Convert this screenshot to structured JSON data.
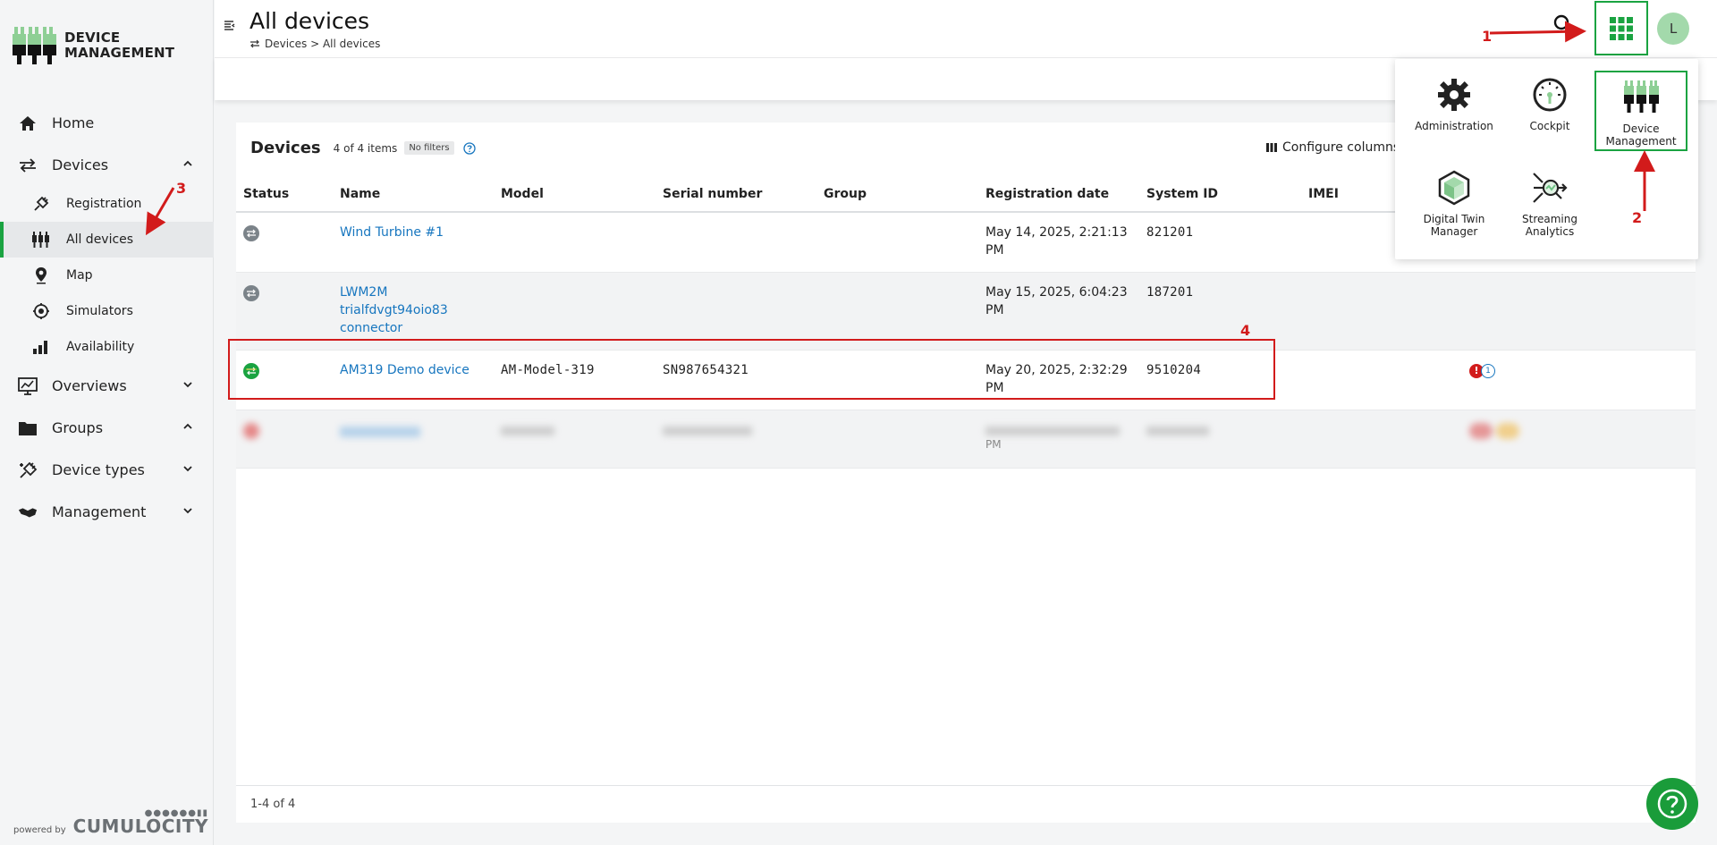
{
  "app": {
    "logo_line1": "DEVICE",
    "logo_line2": "MANAGEMENT",
    "powered_by": "powered by",
    "brand": "CUMULOCITY",
    "accent_color": "#1aa341"
  },
  "sidebar": {
    "items": [
      {
        "label": "Home",
        "icon": "home-icon"
      },
      {
        "label": "Devices",
        "icon": "devices-icon",
        "expanded": true
      },
      {
        "label": "Overviews",
        "icon": "overviews-icon",
        "expanded": false
      },
      {
        "label": "Groups",
        "icon": "groups-icon",
        "expanded": true
      },
      {
        "label": "Device types",
        "icon": "device-types-icon",
        "expanded": false
      },
      {
        "label": "Management",
        "icon": "management-icon",
        "expanded": false
      }
    ],
    "device_subitems": [
      {
        "label": "Registration",
        "icon": "registration-icon"
      },
      {
        "label": "All devices",
        "icon": "all-devices-icon",
        "active": true
      },
      {
        "label": "Map",
        "icon": "map-pin-icon"
      },
      {
        "label": "Simulators",
        "icon": "simulators-icon"
      },
      {
        "label": "Availability",
        "icon": "availability-icon"
      }
    ]
  },
  "header": {
    "title": "All devices",
    "breadcrumb": "Devices > All devices",
    "avatar_initial": "L"
  },
  "devices_card": {
    "title": "Devices",
    "count": "4 of 4 items",
    "filter_badge": "No filters",
    "configure_label": "Configure columns",
    "columns": [
      "Status",
      "Name",
      "Model",
      "Serial number",
      "Group",
      "Registration date",
      "System ID",
      "IMEI"
    ],
    "rows": [
      {
        "status": "offline",
        "name": "Wind Turbine #1",
        "model": "",
        "serial": "",
        "group": "",
        "reg_date": "May 14, 2025, 2:21:13 PM",
        "system_id": "821201",
        "imei": ""
      },
      {
        "status": "offline",
        "name": "LWM2M trialfdvgt94oio83 connector",
        "model": "",
        "serial": "",
        "group": "",
        "reg_date": "May 15, 2025, 6:04:23 PM",
        "system_id": "187201",
        "imei": ""
      },
      {
        "status": "online",
        "name": "AM319 Demo device",
        "model": "AM-Model-319",
        "serial": "SN987654321",
        "group": "",
        "reg_date": "May 20, 2025, 2:32:29 PM",
        "system_id": "9510204",
        "imei": "",
        "alarm_major": "!",
        "alarm_minor": "1"
      },
      {
        "status": "blurred",
        "name": "",
        "model": "",
        "serial": "",
        "group": "",
        "reg_date": "PM",
        "system_id": "",
        "imei": ""
      }
    ],
    "pager": "1-4 of 4"
  },
  "app_menu": {
    "apps": [
      {
        "label": "Administration",
        "icon": "gear-icon"
      },
      {
        "label": "Cockpit",
        "icon": "gauge-icon"
      },
      {
        "label": "Device Management",
        "icon": "device-management-icon",
        "highlighted": true
      },
      {
        "label": "Digital Twin Manager",
        "icon": "cube-icon"
      },
      {
        "label": "Streaming Analytics",
        "icon": "streaming-analytics-icon"
      }
    ]
  },
  "annotations": {
    "step1": "1",
    "step2": "2",
    "step3": "3",
    "step4": "4",
    "color": "#d21b1b"
  }
}
